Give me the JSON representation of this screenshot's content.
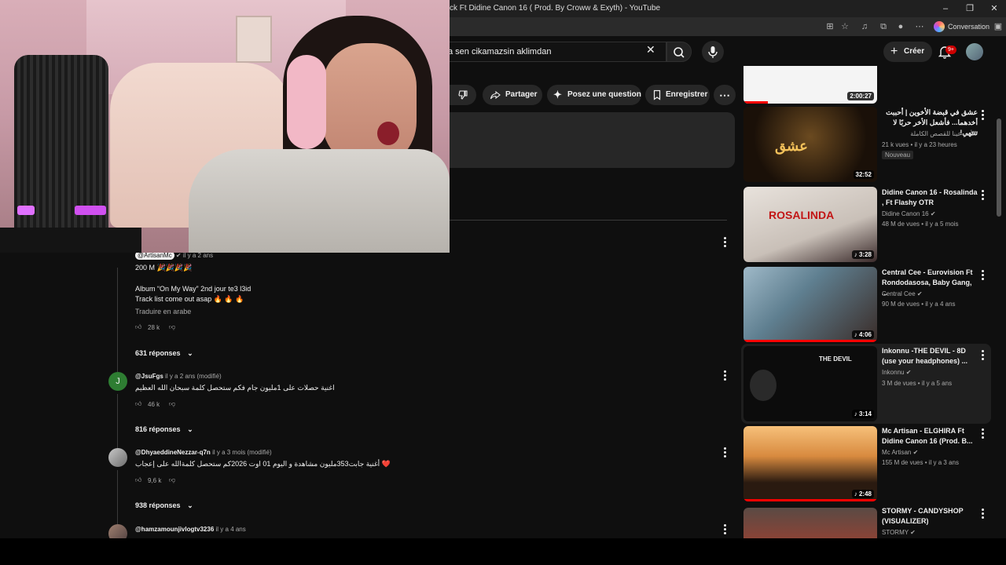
{
  "browser": {
    "window_title": "ck Ft Didine Canon 16 ( Prod. By Croww & Exyth) - YouTube",
    "minimize": "–",
    "maximize": "❐",
    "close": "✕",
    "conversation": "Conversation"
  },
  "topbar": {
    "search_value": "a sen cikamazsin aklimdan",
    "create_label": "Créer",
    "notif_badge": "9+"
  },
  "actions": {
    "share": "Partager",
    "ask": "Posez une question",
    "save": "Enregistrer"
  },
  "comments": [
    {
      "author": "@ArtisanMc",
      "time": "il y a 2 ans",
      "line1": "200 M 🎉🎉🎉🎉",
      "line2": "Album “On My Way” 2nd jour te3 l3id",
      "line3": "Track list come out asap 🔥 🔥 🔥",
      "translate": "Traduire en arabe",
      "likes": "28 k",
      "replies": "631 réponses"
    },
    {
      "author": "@JsuFgs",
      "time": "il y a 2 ans (modifié)",
      "avatar_letter": "J",
      "text": "اغنية حصلات على 1مليون جام فكم ستحصل كلمة سبحان الله العظيم",
      "likes": "46 k",
      "replies": "816 réponses"
    },
    {
      "author": "@DhyaeddineNezzar-q7n",
      "time": "il y a 3 mois (modifié)",
      "text": "أغنية جابت353مليون مشاهدة و اليوم 01 اوت 2026كم ستحصل كلمةالله على إعجاب ❤️",
      "likes": "9,6 k",
      "replies": "938 réponses"
    },
    {
      "author": "@hamzamounjivlogtv3236",
      "time": "il y a 4 ans"
    }
  ],
  "videos": [
    {
      "duration": "2:00:27"
    },
    {
      "title": "عشق في قبضة الأخوين | أحببت أخدهما... فأشعل الأخر حربًا لا تنتهي!",
      "channel": "الأمم عينا للقصص الكاملة",
      "meta": "21 k vues • il y a 23 heures",
      "badge": "Nouveau",
      "duration": "32:52"
    },
    {
      "title": "Didine Canon 16 - Rosalinda , Ft Flashy OTR",
      "channel": "Didine Canon 16",
      "meta": "48 M de vues • il y a 5 mois",
      "duration": "3:28"
    },
    {
      "title": "Central Cee - Eurovision Ft Rondodasosa, Baby Gang, ...",
      "channel": "Central Cee",
      "meta": "90 M de vues • il y a 4 ans",
      "duration": "4:06"
    },
    {
      "title": "Inkonnu -THE DEVIL - 8D (use your headphones) ...",
      "channel": "Inkonnu",
      "meta": "3 M de vues • il y a 5 ans",
      "duration": "3:14",
      "thumb_text": "THE DEVIL"
    },
    {
      "title": "Mc Artisan - ELGHIRA Ft Didine Canon 16 (Prod. B...",
      "channel": "Mc Artisan",
      "meta": "155 M de vues • il y a 3 ans",
      "duration": "2:48"
    },
    {
      "title": "STORMY - CANDYSHOP (VISUALIZER)",
      "channel": "STORMY"
    }
  ],
  "colors": {
    "page_bg": "#0f0f0f",
    "pill_bg": "#272727",
    "accent_red": "#ff0000",
    "muted_text": "#aaaaaa"
  }
}
